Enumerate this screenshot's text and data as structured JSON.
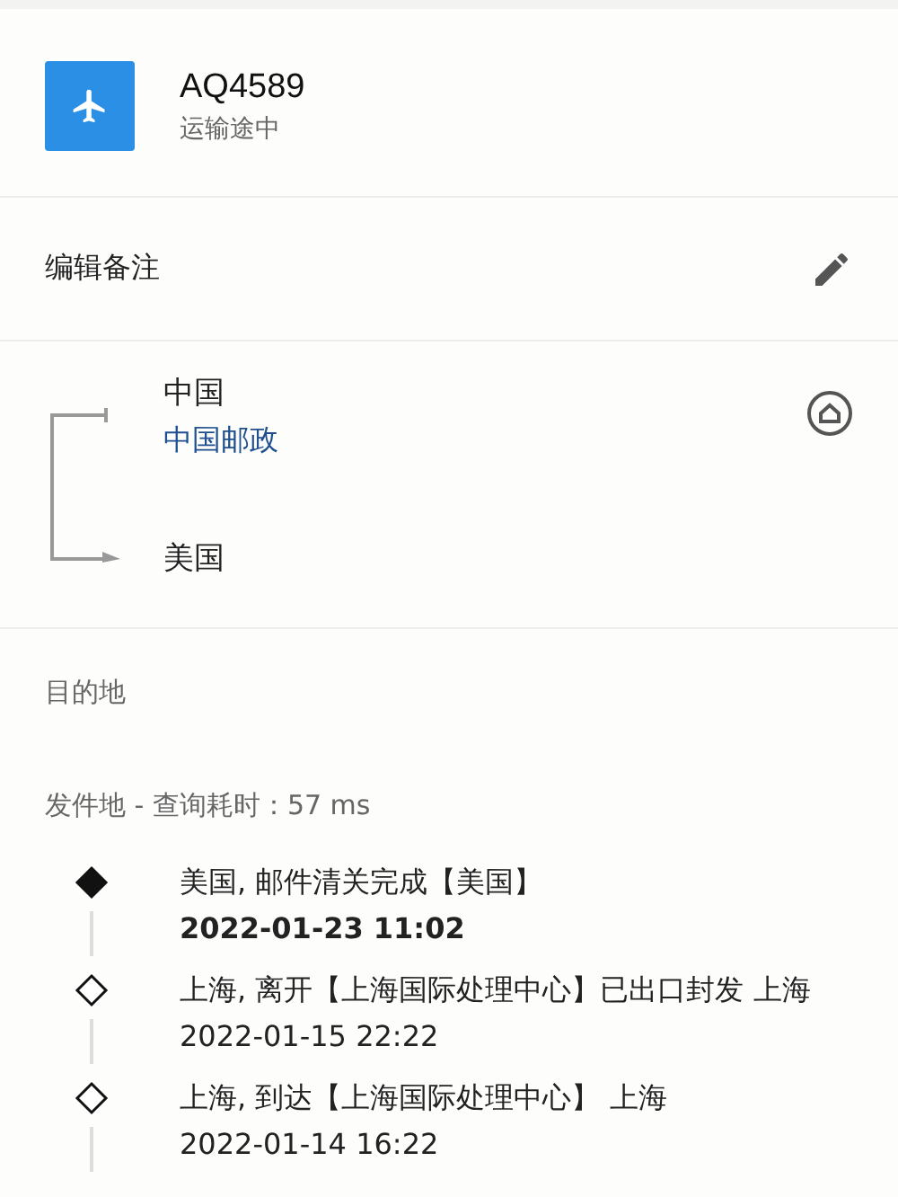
{
  "shipment": {
    "number": "AQ4589",
    "status": "运输途中"
  },
  "note": {
    "label": "编辑备注"
  },
  "route": {
    "origin": "中国",
    "carrier": "中国邮政",
    "destination": "美国"
  },
  "destination_label": "目的地",
  "origin_label": "发件地 - 查询耗时：57 ms",
  "events": [
    {
      "description": "美国, 邮件清关完成【美国】",
      "time": "2022-01-23 11:02",
      "current": true
    },
    {
      "description": "上海, 离开【上海国际处理中心】已出口封发 上海",
      "time": "2022-01-15 22:22",
      "current": false
    },
    {
      "description": "上海, 到达【上海国际处理中心】 上海",
      "time": "2022-01-14 16:22",
      "current": false
    }
  ]
}
